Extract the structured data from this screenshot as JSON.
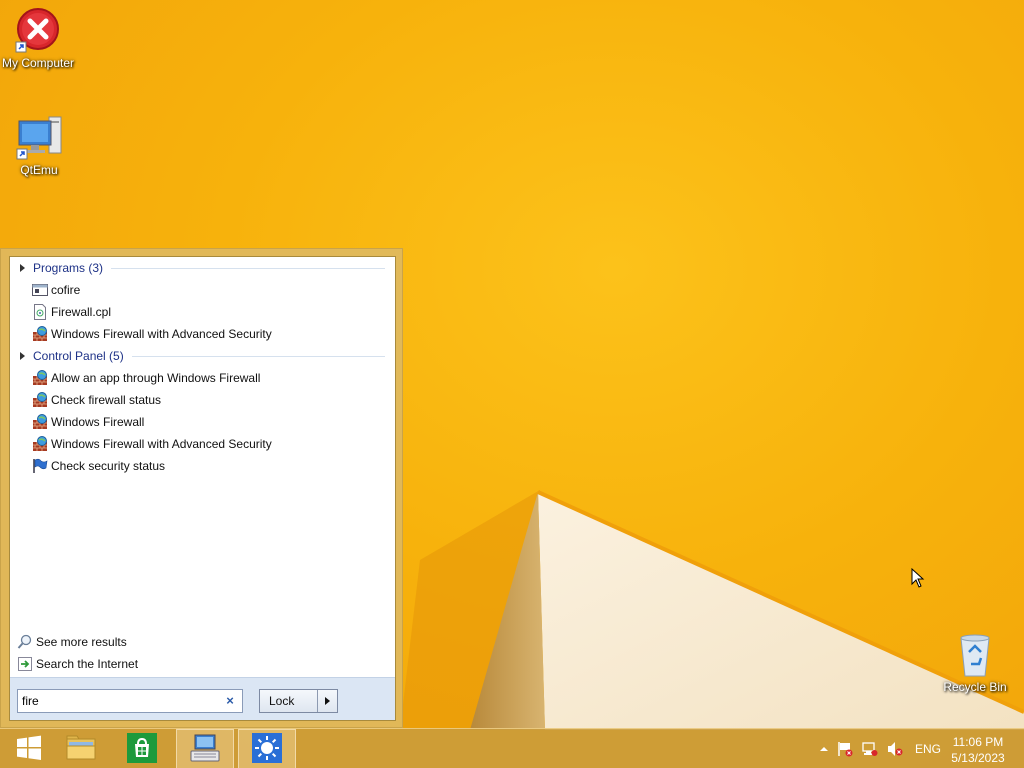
{
  "desktop": {
    "icons": [
      {
        "label": "My Computer",
        "icon": "error-x-icon"
      },
      {
        "label": "QtEmu",
        "icon": "computer-monitor-icon"
      },
      {
        "label": "Recycle Bin",
        "icon": "recycle-bin-icon"
      }
    ]
  },
  "start_menu": {
    "groups": [
      {
        "title": "Programs (3)",
        "items": [
          {
            "label": "cofire",
            "icon": "app-window-icon"
          },
          {
            "label": "Firewall.cpl",
            "icon": "cpl-file-icon"
          },
          {
            "label": "Windows Firewall with Advanced Security",
            "icon": "firewall-icon"
          }
        ]
      },
      {
        "title": "Control Panel (5)",
        "items": [
          {
            "label": "Allow an app through Windows Firewall",
            "icon": "firewall-icon"
          },
          {
            "label": "Check firewall status",
            "icon": "firewall-icon"
          },
          {
            "label": "Windows Firewall",
            "icon": "firewall-icon"
          },
          {
            "label": "Windows Firewall with Advanced Security",
            "icon": "firewall-icon"
          },
          {
            "label": "Check security status",
            "icon": "action-center-flag-icon"
          }
        ]
      }
    ],
    "links": [
      {
        "label": "See more results",
        "icon": "magnifier-icon"
      },
      {
        "label": "Search the Internet",
        "icon": "internet-arrow-icon"
      }
    ],
    "search": {
      "value": "fire",
      "clear": "×"
    },
    "power_button": {
      "label": "Lock"
    }
  },
  "taskbar": {
    "buttons": [
      {
        "name": "start",
        "icon": "windows-logo-icon"
      },
      {
        "name": "file-explorer",
        "icon": "folder-icon"
      },
      {
        "name": "store",
        "icon": "store-bag-icon"
      },
      {
        "name": "onscreen-keyboard",
        "icon": "keyboard-icon"
      },
      {
        "name": "app-sun",
        "icon": "sun-icon"
      }
    ],
    "tray": {
      "language": "ENG",
      "time": "11:06 PM",
      "date": "5/13/2023"
    }
  },
  "colors": {
    "wallpaper": "#f7b20c",
    "group_header": "#1e3287",
    "search_area": "#dbe6f4"
  }
}
